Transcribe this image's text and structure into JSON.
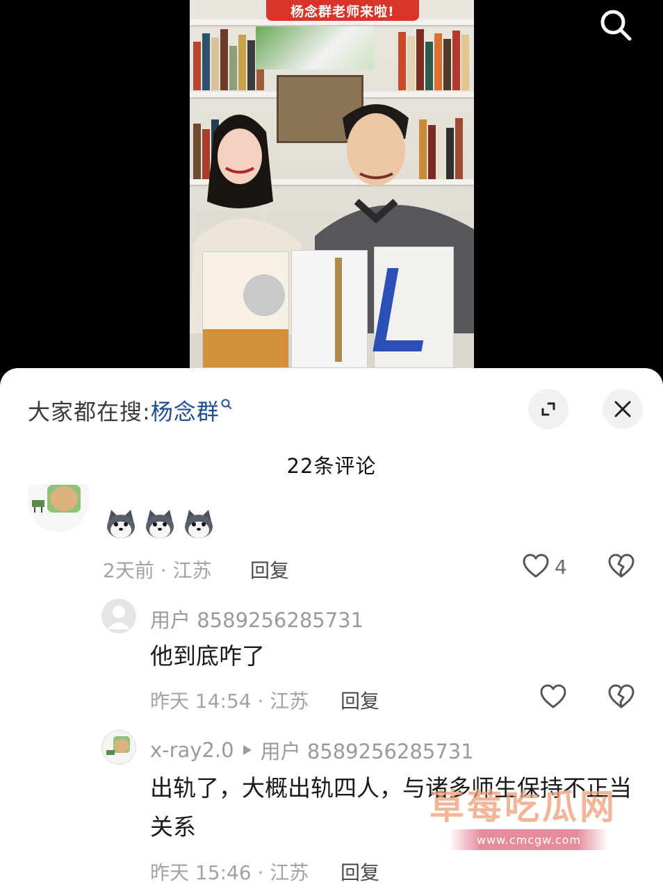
{
  "video": {
    "caption_line": "杨念群老师来啦!"
  },
  "trending": {
    "label": "大家都在搜:",
    "keyword": "杨念群"
  },
  "comment_count": "22条评论",
  "comments": [
    {
      "text": "",
      "emojis": [
        "husky-emoji",
        "husky-emoji",
        "husky-emoji"
      ],
      "meta": "2天前 · 江苏",
      "reply_label": "回复",
      "like_count": "4"
    }
  ],
  "replies": [
    {
      "username": "用户 8589256285731",
      "text": "他到底咋了",
      "meta": "昨天 14:54 · 江苏",
      "reply_label": "回复"
    },
    {
      "username": "x-ray2.0",
      "reply_to": "用户 8589256285731",
      "text": "出轨了，大概出轨四人，与诸多师生保持不正当关系",
      "meta": "昨天 15:46 · 江苏",
      "reply_label": "回复"
    }
  ],
  "watermark": {
    "text": "草莓吃瓜网",
    "url": "www.cmcgw.com"
  },
  "colors": {
    "panel_bg": "#ffffff",
    "keyword": "#1f4d8f",
    "meta": "#a3a3a3",
    "banner": "#d8342a"
  },
  "icons": [
    "search-icon",
    "expand-icon",
    "close-icon",
    "heart-icon",
    "broken-heart-icon",
    "user-avatar-icon",
    "triangle-right-icon"
  ]
}
